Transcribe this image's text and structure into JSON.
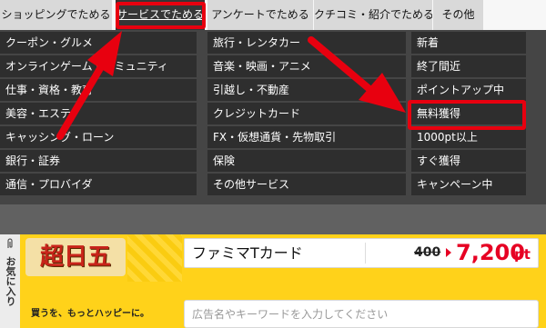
{
  "tabs": [
    {
      "label": "ショッピングでためる"
    },
    {
      "label": "サービスでためる"
    },
    {
      "label": "アンケートでためる"
    },
    {
      "label": "クチコミ・紹介でためる"
    },
    {
      "label": "その他"
    }
  ],
  "columns": {
    "col1": [
      "クーポン・グルメ",
      "オンラインゲーム・コミュニティ",
      "仕事・資格・教育",
      "美容・エステ",
      "キャッシング・ローン",
      "銀行・証券",
      "通信・プロバイダ"
    ],
    "col2": [
      "旅行・レンタカー",
      "音楽・映画・アニメ",
      "引越し・不動産",
      "クレジットカード",
      "FX・仮想通貨・先物取引",
      "保険",
      "その他サービス"
    ],
    "col3": [
      "新着",
      "終了間近",
      "ポイントアップ中",
      "無料獲得",
      "1000pt以上",
      "すぐ獲得",
      "キャンペーン中"
    ]
  },
  "sidebar": {
    "favorites_label": "お気に入り"
  },
  "banner": {
    "logo_text": "超日五",
    "tagline": "買うを、もっとハッピーに。",
    "card_name": "ファミマTカード",
    "old_price": "400",
    "new_price": "7,200",
    "price_unit": "pt"
  },
  "search": {
    "placeholder": "広告名やキーワードを入力してください"
  },
  "colors": {
    "highlight": "#e8000f",
    "price_red": "#e60023",
    "menu_bg": "#2e2e2e"
  },
  "icons": {
    "favorites": "paperclip-icon",
    "price_arrow": "arrow-right-icon"
  }
}
